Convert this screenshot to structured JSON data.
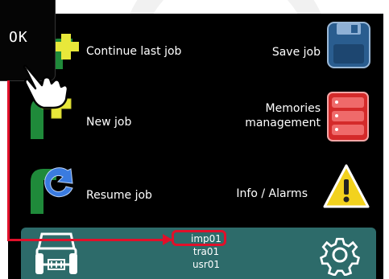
{
  "device": {
    "ok_button_label": "OK"
  },
  "menu": {
    "continue_last_job": "Continue last job",
    "save_job": "Save job",
    "new_job": "New job",
    "memories_management_line1": "Memories",
    "memories_management_line2": "management",
    "resume_job": "Resume job",
    "info_alarms": "Info / Alarms"
  },
  "status_bar": {
    "profiles": [
      "imp01",
      "tra01",
      "usr01"
    ]
  },
  "colors": {
    "accent_red": "#e0102a",
    "status_bar_teal": "#2d6b6a",
    "job_icon_green": "#1f8a3a",
    "plus_yellow": "#e8e83a",
    "save_icon_blue": "#2a5d8f",
    "memories_red": "#d42a2a",
    "warning_yellow": "#f2d21e"
  }
}
